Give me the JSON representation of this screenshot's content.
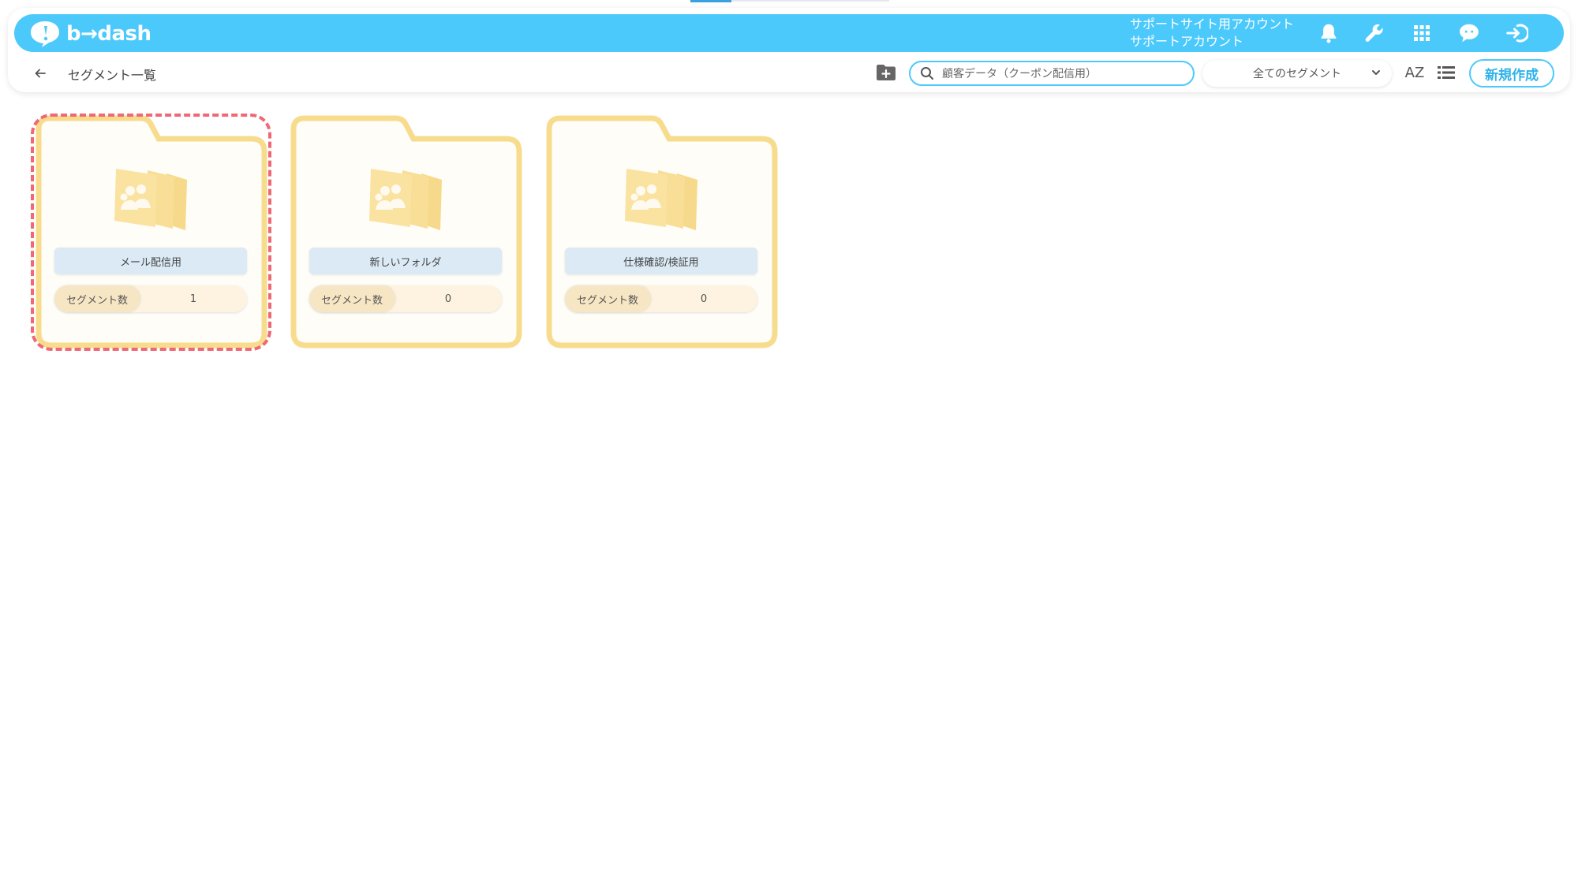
{
  "app": {
    "logo_text": "b→dash",
    "brand_color": "#4cc9fb"
  },
  "header": {
    "account_line1": "サポートサイト用アカウント",
    "account_line2": "サポートアカウント",
    "icons": [
      "bell-icon",
      "wrench-icon",
      "apps-grid-icon",
      "chat-icon",
      "logout-icon"
    ]
  },
  "toolbar": {
    "page_title": "セグメント一覧",
    "search_value": "顧客データ（クーポン配信用）",
    "filter_selected": "全てのセグメント",
    "sort_label": "AZ",
    "new_button_label": "新規作成"
  },
  "folders": [
    {
      "name": "メール配信用",
      "count_label": "セグメント数",
      "count": "1"
    },
    {
      "name": "新しいフォルダ",
      "count_label": "セグメント数",
      "count": "0"
    },
    {
      "name": "仕様確認/検証用",
      "count_label": "セグメント数",
      "count": "0"
    }
  ],
  "colors": {
    "folder_fill": "#fffdf7",
    "folder_border": "#f8dc8e",
    "highlight": "#ef6874"
  }
}
